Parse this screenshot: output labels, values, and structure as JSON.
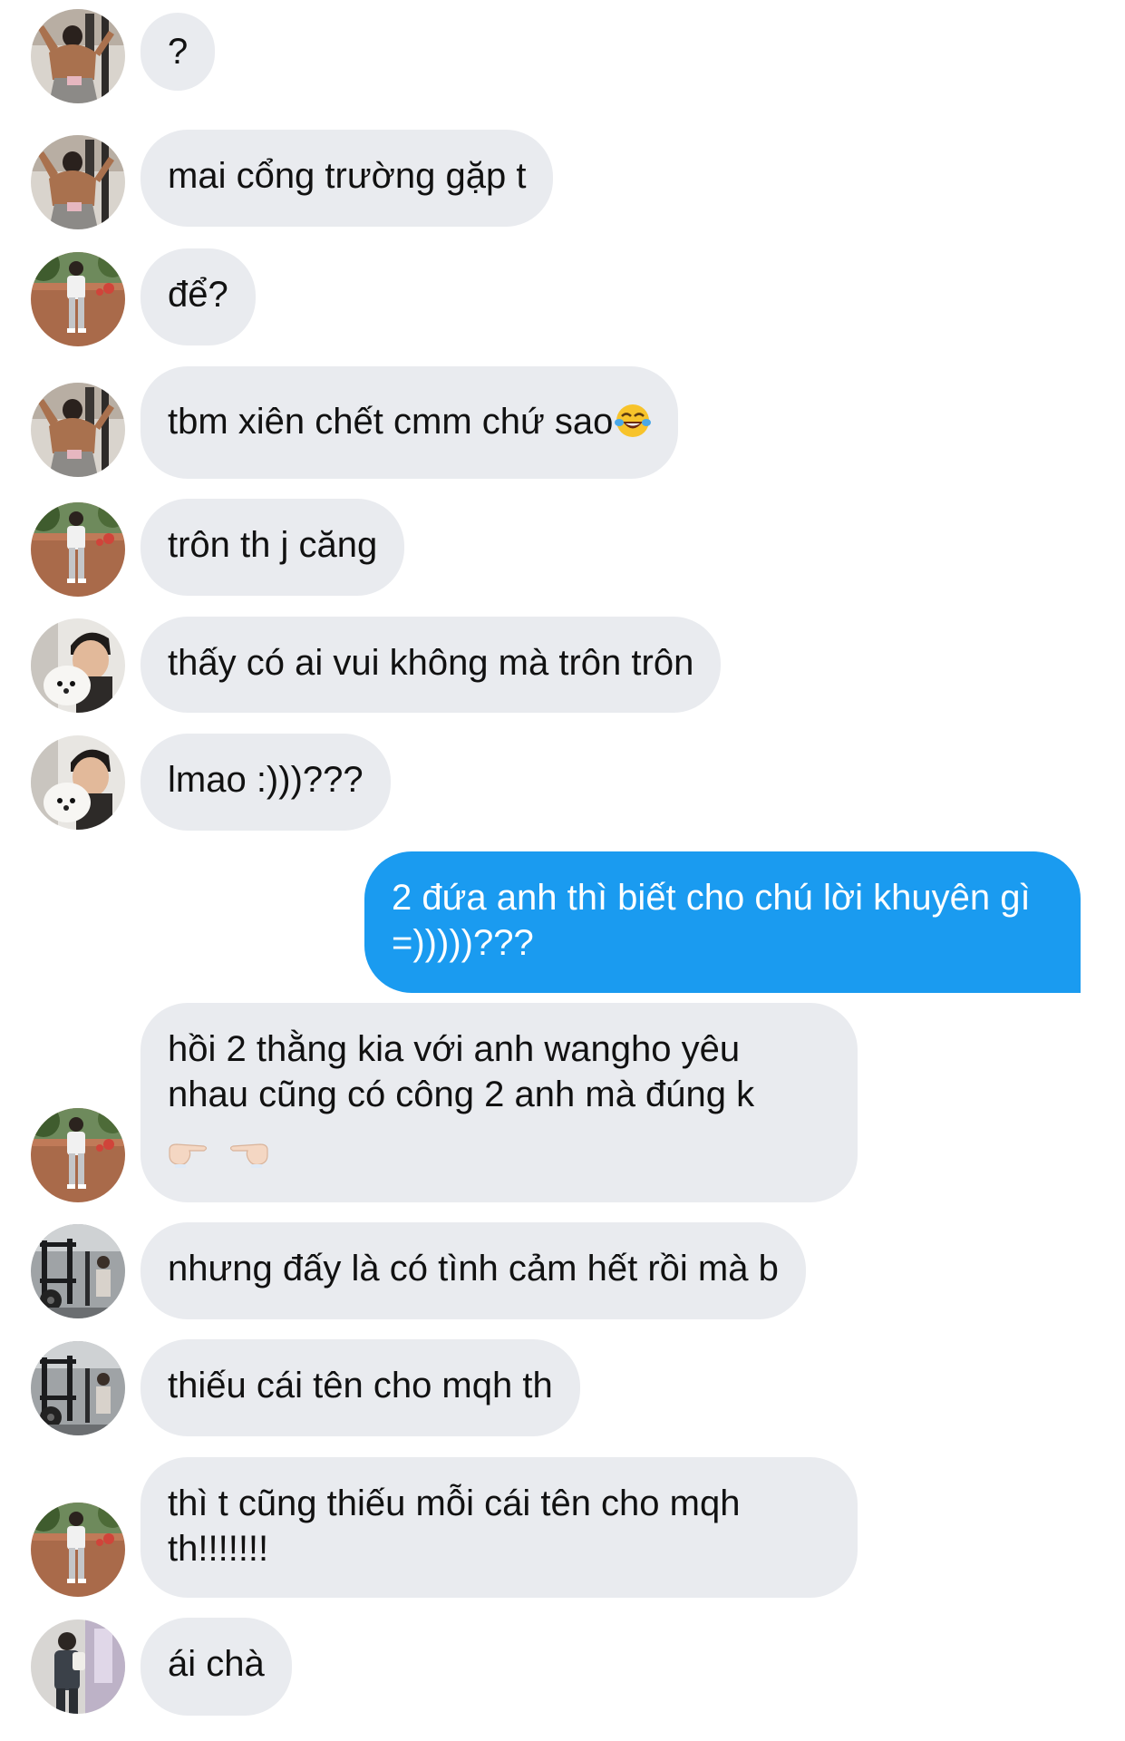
{
  "messages": [
    {
      "sender": "user-a",
      "text": "?",
      "avatar_icon": "shirtless-gym-avatar-icon"
    },
    {
      "sender": "user-a",
      "text": "mai cổng trường gặp t",
      "avatar_icon": "shirtless-gym-avatar-icon"
    },
    {
      "sender": "user-b",
      "text": "để?",
      "avatar_icon": "outdoor-standing-avatar-icon"
    },
    {
      "sender": "user-a",
      "text": "tbm xiên chết cmm chứ sao",
      "avatar_icon": "shirtless-gym-avatar-icon",
      "trailing_emoji": "face-with-tears-of-joy-emoji"
    },
    {
      "sender": "user-b",
      "text": "trôn th j căng",
      "avatar_icon": "outdoor-standing-avatar-icon"
    },
    {
      "sender": "user-c",
      "text": "thấy có ai vui không mà trôn trôn",
      "avatar_icon": "person-with-white-dog-avatar-icon"
    },
    {
      "sender": "user-c",
      "text": "lmao :)))???",
      "avatar_icon": "person-with-white-dog-avatar-icon"
    },
    {
      "sender": "me",
      "text": "2 đứa anh thì biết cho chú lời khuyên gì =)))))???"
    },
    {
      "sender": "user-b",
      "text": "hồi 2 thằng kia với anh wangho yêu nhau cũng có công 2 anh mà đúng k",
      "avatar_icon": "outdoor-standing-avatar-icon",
      "trailing_emojis": [
        "pointing-right-emoji",
        "pointing-left-emoji"
      ]
    },
    {
      "sender": "user-d",
      "text": "nhưng đấy là có tình cảm hết rồi mà b",
      "avatar_icon": "gym-equipment-avatar-icon"
    },
    {
      "sender": "user-d",
      "text": "thiếu cái tên cho mqh th",
      "avatar_icon": "gym-equipment-avatar-icon"
    },
    {
      "sender": "user-b",
      "text": "thì t cũng thiếu mỗi cái tên cho mqh th!!!!!!!",
      "avatar_icon": "outdoor-standing-avatar-icon"
    },
    {
      "sender": "user-e",
      "text": "ái chà",
      "avatar_icon": "person-indoor-avatar-icon"
    }
  ],
  "colors": {
    "incoming_bubble": "#e9ebef",
    "outgoing_bubble": "#1a9bf0",
    "incoming_text": "#111111",
    "outgoing_text": "#ffffff",
    "background": "#ffffff"
  }
}
